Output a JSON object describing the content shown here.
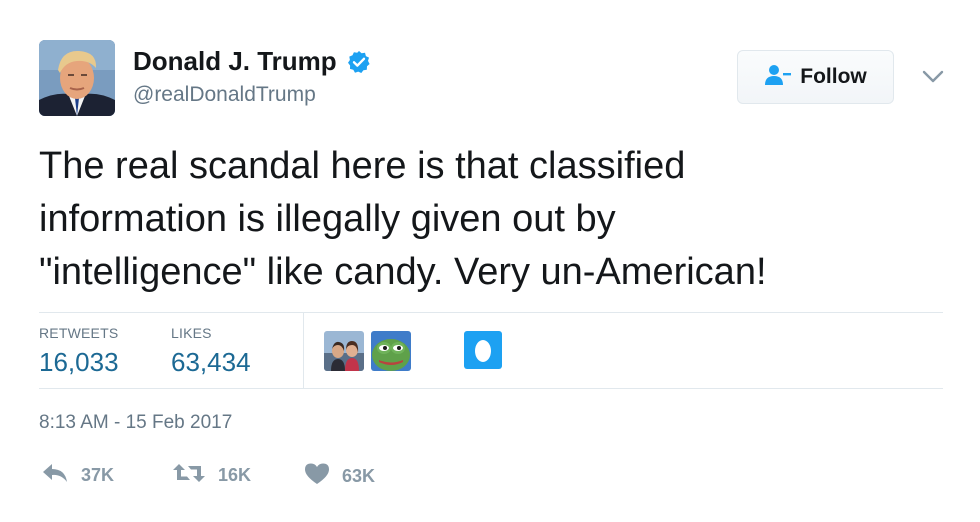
{
  "user": {
    "name": "Donald J. Trump",
    "handle": "@realDonaldTrump",
    "avatar_icon": "profile-photo"
  },
  "follow_button": {
    "label": "Follow",
    "icon": "follow-person-icon"
  },
  "tweet": {
    "text_lines": [
      "The real scandal here is that classified",
      "information is illegally given out by",
      "\"intelligence\" like candy. Very un-American!"
    ]
  },
  "stats": {
    "retweets_label": "RETWEETS",
    "retweets_value": "16,033",
    "likes_label": "LIKES",
    "likes_value": "63,434"
  },
  "timestamp": "8:13 AM - 15 Feb 2017",
  "actions": {
    "reply_count": "37K",
    "retweet_count": "16K",
    "like_count": "63K"
  },
  "colors": {
    "accent": "#1da1f2",
    "stat_value": "#1c6994",
    "muted": "#657786",
    "icon_gray": "#8899a6"
  }
}
